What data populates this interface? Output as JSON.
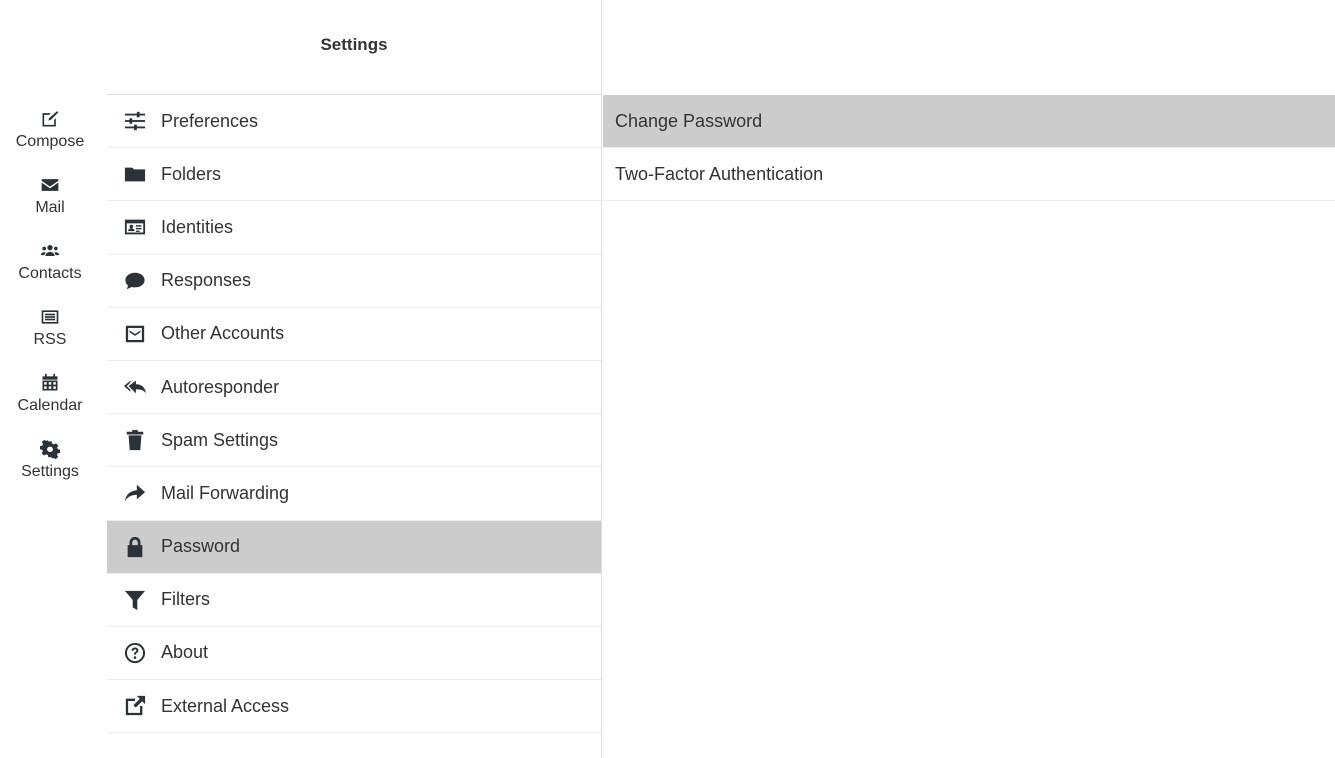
{
  "rail": {
    "items": [
      {
        "label": "Compose",
        "icon": "compose-icon"
      },
      {
        "label": "Mail",
        "icon": "envelope-icon"
      },
      {
        "label": "Contacts",
        "icon": "users-icon"
      },
      {
        "label": "RSS",
        "icon": "rss-icon"
      },
      {
        "label": "Calendar",
        "icon": "calendar-icon"
      },
      {
        "label": "Settings",
        "icon": "gear-icon"
      }
    ]
  },
  "settings": {
    "title": "Settings",
    "items": [
      {
        "label": "Preferences",
        "icon": "sliders-icon"
      },
      {
        "label": "Folders",
        "icon": "folder-icon"
      },
      {
        "label": "Identities",
        "icon": "id-card-icon"
      },
      {
        "label": "Responses",
        "icon": "comment-icon"
      },
      {
        "label": "Other Accounts",
        "icon": "envelope-square-icon"
      },
      {
        "label": "Autoresponder",
        "icon": "reply-all-icon"
      },
      {
        "label": "Spam Settings",
        "icon": "trash-icon"
      },
      {
        "label": "Mail Forwarding",
        "icon": "share-icon"
      },
      {
        "label": "Password",
        "icon": "lock-icon",
        "active": true
      },
      {
        "label": "Filters",
        "icon": "filter-icon"
      },
      {
        "label": "About",
        "icon": "question-circle-icon"
      },
      {
        "label": "External Access",
        "icon": "external-link-icon"
      }
    ]
  },
  "content": {
    "items": [
      {
        "label": "Change Password",
        "active": true
      },
      {
        "label": "Two-Factor Authentication"
      }
    ]
  },
  "colors": {
    "active_bg": "#cccccc",
    "icon": "#2c3338",
    "border": "#dddddd"
  }
}
